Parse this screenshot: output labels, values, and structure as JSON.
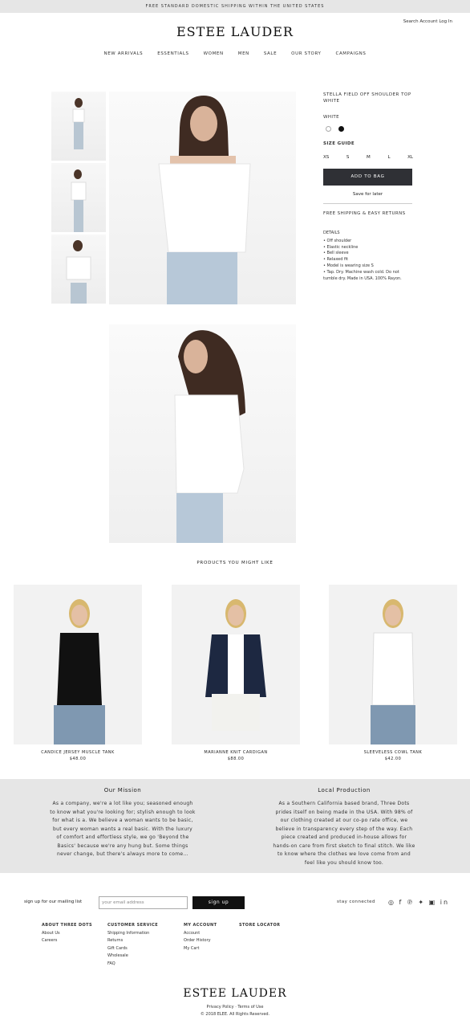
{
  "promo": "FREE STANDARD DOMESTIC SHIPPING WITHIN THE UNITED STATES",
  "account": "Search Account Log In",
  "brand": "ESTEE LAUDER",
  "nav": [
    "NEW ARRIVALS",
    "ESSENTIALS",
    "WOMEN",
    "MEN",
    "SALE",
    "OUR STORY",
    "CAMPAIGNS"
  ],
  "product": {
    "title": "STELLA FIELD OFF SHOULDER TOP WHITE",
    "color_label": "WHITE",
    "swatches": [
      "#ffffff",
      "#111111"
    ],
    "size_guide": "SIZE GUIDE",
    "sizes": [
      "XS",
      "S",
      "M",
      "L",
      "XL"
    ],
    "add_to_bag": "ADD TO BAG",
    "save_for_later": "Save for later",
    "shipping": "FREE SHIPPING & EASY RETURNS",
    "details_title": "DETAILS",
    "details": [
      "• Off shoulder",
      "• Elastic neckline",
      "• Bell sleeve",
      "• Relaxed fit",
      "• Model is wearing size S",
      "• Tap. Dry. Machine wash cold. Do not tumble dry. Made in USA. 100% Rayon."
    ]
  },
  "recommend_title": "PRODUCTS YOU MIGHT LIKE",
  "recommendations": [
    {
      "name": "CANDICE JERSEY MUSCLE TANK",
      "price": "$48.00"
    },
    {
      "name": "MARIANNE KNIT CARDIGAN",
      "price": "$88.00"
    },
    {
      "name": "SLEEVELESS COWL TANK",
      "price": "$42.00"
    }
  ],
  "mission": {
    "title": "Our Mission",
    "text": "As a company, we're a lot like you; seasoned enough to know what you're looking for; stylish enough to look for what is a. We believe a woman wants to be basic, but every woman wants a real basic. With the luxury of comfort and effortless style, we go 'Beyond the Basics' because we're any hung but. Some things never change, but there's always more to come..."
  },
  "local": {
    "title": "Local Production",
    "text": "As a Southern California based brand, Three Dots prides itself on being made in the USA. With 98% of our clothing created at our co-po rate office, we believe in transparency every step of the way. Each piece created and produced in-house allows for hands-on care from first sketch to final stitch. We like to know where the clothes we love come from and feel like you should know too."
  },
  "footer": {
    "mailing_label": "sign up for our mailing list",
    "email_placeholder": "your email address",
    "signup": "sign up",
    "stay_connected": "stay connected",
    "social_icons": "◎ f ℗ ✦ ▣ in",
    "columns": [
      {
        "title": "ABOUT THREE DOTS",
        "items": [
          "About Us",
          "Careers"
        ]
      },
      {
        "title": "CUSTOMER SERVICE",
        "items": [
          "Shipping Information",
          "Returns",
          "Gift Cards",
          "Wholesale",
          "FAQ"
        ]
      },
      {
        "title": "MY ACCOUNT",
        "items": [
          "Account",
          "Order History",
          "My Cart"
        ]
      },
      {
        "title": "STORE LOCATOR",
        "items": []
      }
    ],
    "legal": "Privacy Policy · Terms of Use",
    "copyright": "© 2018 ELEE. All Rights Reserved."
  }
}
